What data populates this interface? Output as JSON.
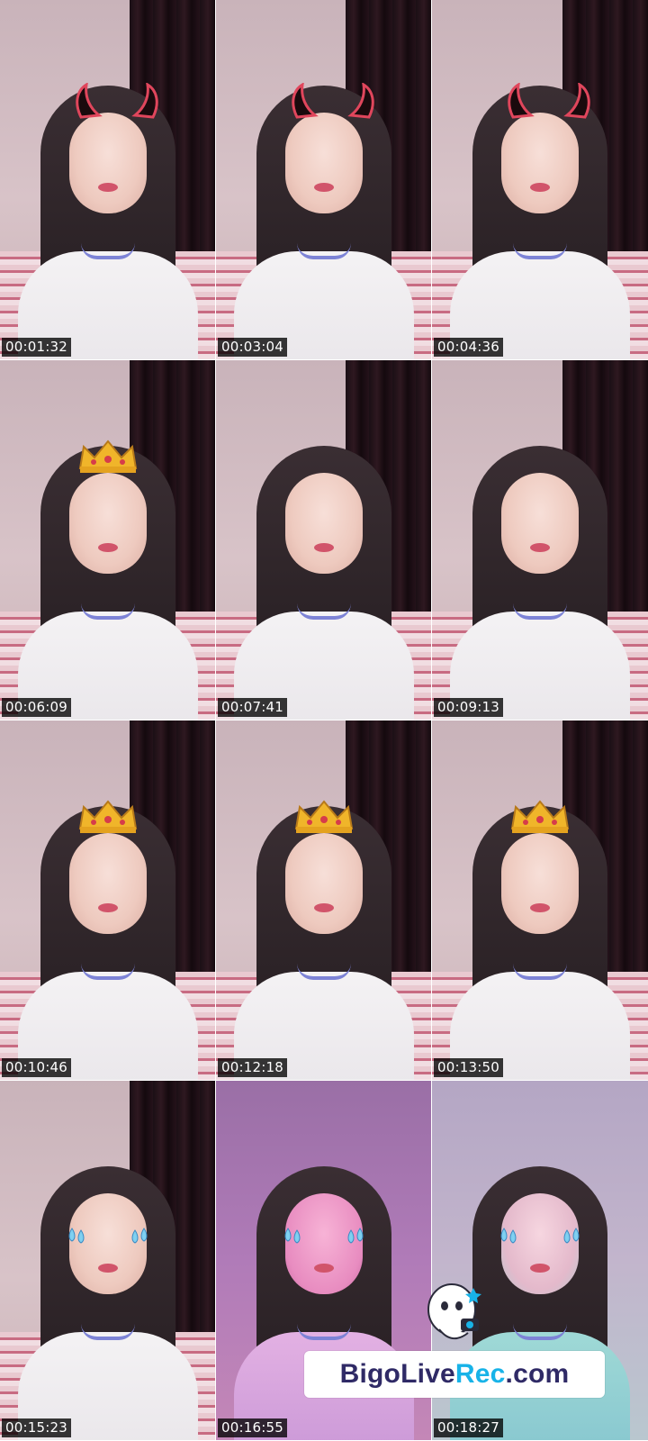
{
  "thumbnails": [
    {
      "timestamp": "00:01:32",
      "filter": "devil-horns",
      "tint": ""
    },
    {
      "timestamp": "00:03:04",
      "filter": "devil-horns",
      "tint": ""
    },
    {
      "timestamp": "00:04:36",
      "filter": "devil-horns",
      "tint": ""
    },
    {
      "timestamp": "00:06:09",
      "filter": "crown",
      "tint": ""
    },
    {
      "timestamp": "00:07:41",
      "filter": "none",
      "tint": ""
    },
    {
      "timestamp": "00:09:13",
      "filter": "none",
      "tint": ""
    },
    {
      "timestamp": "00:10:46",
      "filter": "crown",
      "tint": ""
    },
    {
      "timestamp": "00:12:18",
      "filter": "crown",
      "tint": ""
    },
    {
      "timestamp": "00:13:50",
      "filter": "crown",
      "tint": ""
    },
    {
      "timestamp": "00:15:23",
      "filter": "tears",
      "tint": ""
    },
    {
      "timestamp": "00:16:55",
      "filter": "tears",
      "tint": "pink"
    },
    {
      "timestamp": "00:18:27",
      "filter": "tears",
      "tint": "teal"
    }
  ],
  "watermark": {
    "part1": "BigoLive",
    "part2": "Rec",
    "part3": ".com",
    "colors": {
      "part1": "#2f2a66",
      "part2": "#18b3e8",
      "part3": "#2f2a66"
    }
  },
  "icons": {
    "mascot": "bigo-mascot-icon"
  }
}
